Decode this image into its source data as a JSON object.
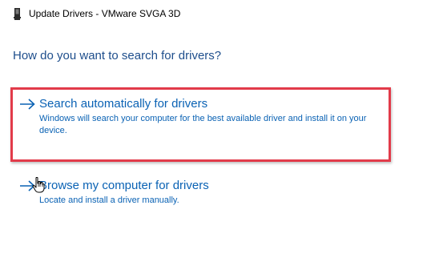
{
  "window": {
    "title": "Update Drivers - VMware SVGA 3D",
    "icon": "device-card-icon"
  },
  "main": {
    "question": "How do you want to search for drivers?",
    "options": [
      {
        "title": "Search automatically for drivers",
        "description": "Windows will search your computer for the best available driver and install it on your device.",
        "icon": "arrow-right-icon",
        "highlighted": true
      },
      {
        "title": "Browse my computer for drivers",
        "description": "Locate and install a driver manually.",
        "icon": "arrow-right-icon",
        "highlighted": false
      }
    ]
  },
  "colors": {
    "link": "#0a62b4",
    "heading": "#1e4e8c",
    "highlight_border": "#e23b4a"
  },
  "cursor": {
    "type": "hand-pointer-icon"
  }
}
